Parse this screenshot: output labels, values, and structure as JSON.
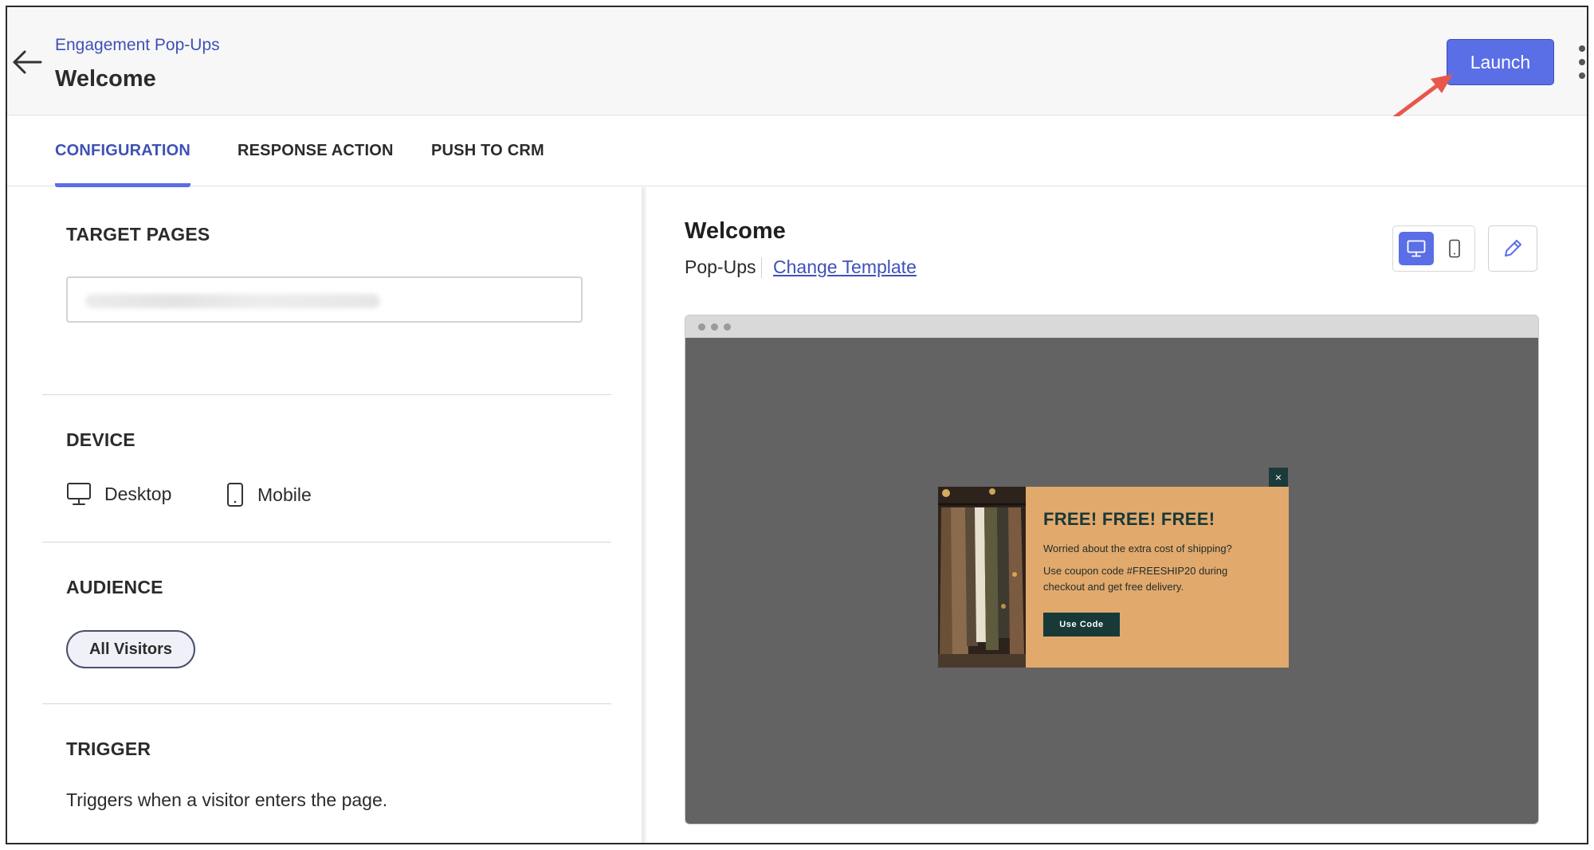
{
  "header": {
    "breadcrumb": "Engagement Pop-Ups",
    "title": "Welcome",
    "launch_label": "Launch"
  },
  "tabs": [
    {
      "label": "CONFIGURATION",
      "active": true
    },
    {
      "label": "RESPONSE ACTION",
      "active": false
    },
    {
      "label": "PUSH TO CRM",
      "active": false
    }
  ],
  "config": {
    "target_pages": {
      "title": "TARGET PAGES"
    },
    "device": {
      "title": "DEVICE",
      "options": [
        {
          "label": "Desktop",
          "icon": "desktop-icon"
        },
        {
          "label": "Mobile",
          "icon": "mobile-icon"
        }
      ]
    },
    "audience": {
      "title": "AUDIENCE",
      "chip": "All Visitors"
    },
    "trigger": {
      "title": "TRIGGER",
      "description": "Triggers when a visitor enters the page."
    }
  },
  "preview": {
    "title": "Welcome",
    "type": "Pop-Ups",
    "change_template": "Change Template",
    "popup": {
      "heading": "FREE! FREE! FREE!",
      "line1": "Worried about the extra cost of shipping?",
      "line2": "Use coupon code #FREESHIP20 during checkout and get free delivery.",
      "button": "Use Code",
      "close": "×"
    }
  },
  "colors": {
    "accent": "#5a6ee6",
    "link": "#3f51b5",
    "annotation_arrow": "#e8574a",
    "popup_bg": "#e2a96c",
    "popup_dark": "#173a39"
  }
}
